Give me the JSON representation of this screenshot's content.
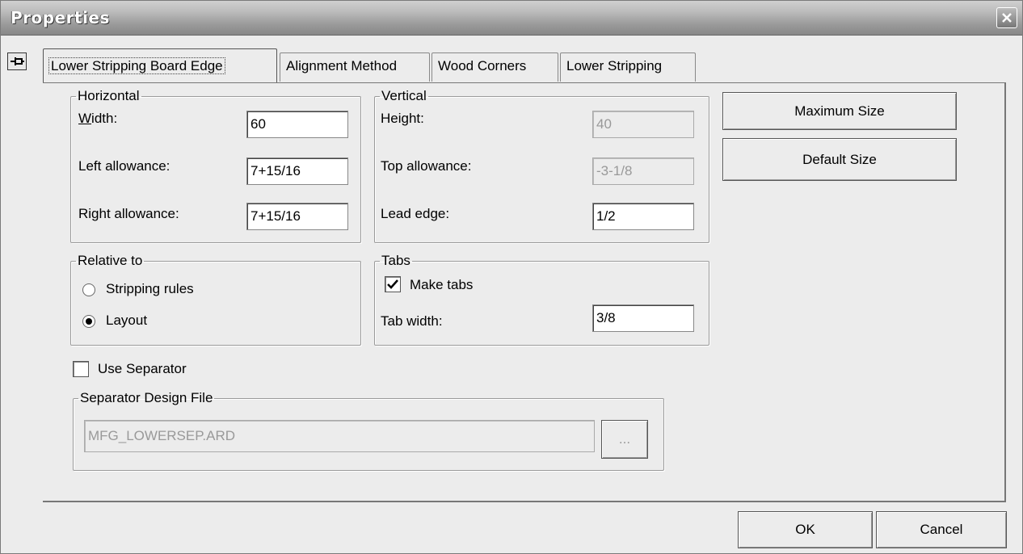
{
  "window": {
    "title": "Properties",
    "close_icon": "close-icon",
    "pin_icon": "pin-icon"
  },
  "tabs": [
    {
      "label": "Lower Stripping Board Edge",
      "active": true
    },
    {
      "label": "Alignment Method",
      "active": false
    },
    {
      "label": "Wood Corners",
      "active": false
    },
    {
      "label": "Lower Stripping",
      "active": false
    }
  ],
  "horizontal": {
    "title": "Horizontal",
    "width_label": "Width:",
    "width_value": "60",
    "left_label": "Left allowance:",
    "left_value": "7+15/16",
    "right_label": "Right allowance:",
    "right_value": "7+15/16"
  },
  "vertical": {
    "title": "Vertical",
    "height_label": "Height:",
    "height_value": "40",
    "top_label": "Top allowance:",
    "top_value": "-3-1/8",
    "lead_label": "Lead edge:",
    "lead_value": "1/2"
  },
  "relative": {
    "title": "Relative to",
    "option1": "Stripping rules",
    "option1_selected": false,
    "option2": "Layout",
    "option2_selected": true
  },
  "tabs_group": {
    "title": "Tabs",
    "make_tabs_label": "Make tabs",
    "make_tabs_checked": true,
    "tab_width_label": "Tab width:",
    "tab_width_value": "3/8"
  },
  "separator": {
    "use_label": "Use Separator",
    "use_checked": false,
    "title": "Separator Design File",
    "file_value": "MFG_LOWERSEP.ARD",
    "browse_label": "..."
  },
  "side_buttons": {
    "max_label": "Maximum Size",
    "default_label": "Default Size"
  },
  "footer": {
    "ok_label": "OK",
    "cancel_label": "Cancel"
  }
}
